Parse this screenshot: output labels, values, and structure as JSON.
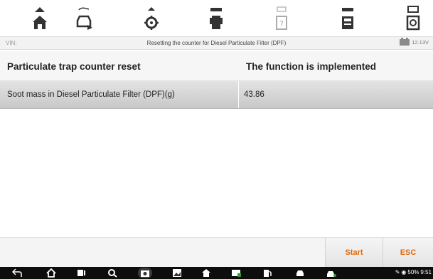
{
  "toolbar": {
    "items": [
      {
        "name": "home-icon"
      },
      {
        "name": "vehicle-swap-icon"
      },
      {
        "name": "settings-icon"
      },
      {
        "name": "print-icon"
      },
      {
        "name": "help-icon"
      },
      {
        "name": "save-icon"
      },
      {
        "name": "data-log-icon"
      }
    ]
  },
  "vinbar": {
    "label": "VIN:",
    "title": "Resetting the counter for Diesel Particulate Filter (DPF)",
    "voltage": "12.13V"
  },
  "table": {
    "headers": [
      "Particulate trap counter reset",
      "The function is implemented"
    ],
    "rows": [
      {
        "name": "Soot mass in Diesel Particulate Filter (DPF)(g)",
        "value": "43.86"
      }
    ]
  },
  "actions": {
    "start_label": "Start",
    "esc_label": "ESC",
    "accent_color": "#e06a10"
  },
  "navbar": {
    "status_text": "50%",
    "time": "9:51"
  }
}
